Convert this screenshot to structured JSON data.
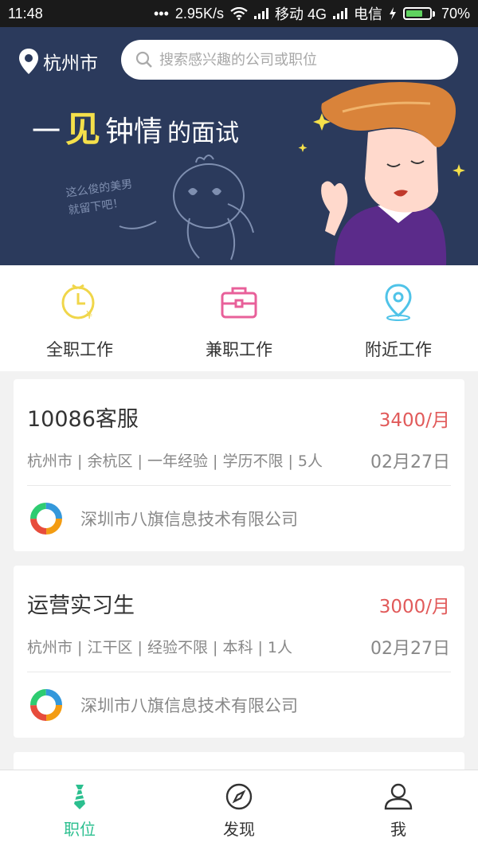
{
  "status_bar": {
    "time": "11:48",
    "dots": "•••",
    "net_speed": "2.95K/s",
    "carrier1": "移动 4G",
    "carrier2": "电信",
    "battery": "70%",
    "battery_level": 0.7
  },
  "banner": {
    "city": "杭州市",
    "search_placeholder": "搜索感兴趣的公司或职位",
    "headline_pre": "一",
    "headline_big": "见",
    "headline_mid": "钟情",
    "headline_post": "的面试",
    "scribble_line1": "这么俊的美男",
    "scribble_line2": "就留下吧！",
    "colors": {
      "background": "#2b3a5c",
      "accent": "#f5e04a"
    }
  },
  "categories": [
    {
      "label": "全职工作",
      "icon": "clock-money-icon",
      "color": "#f0d64a"
    },
    {
      "label": "兼职工作",
      "icon": "briefcase-icon",
      "color": "#e8609a"
    },
    {
      "label": "附近工作",
      "icon": "location-pin-icon",
      "color": "#4fc3e8"
    }
  ],
  "jobs": [
    {
      "title": "10086客服",
      "salary": "3400/月",
      "meta": "杭州市 | 余杭区 | 一年经验 | 学历不限 | 5人",
      "date": "02月27日",
      "company": "深圳市八旗信息技术有限公司"
    },
    {
      "title": "运营实习生",
      "salary": "3000/月",
      "meta": "杭州市 | 江干区 | 经验不限 | 本科 | 1人",
      "date": "02月27日",
      "company": "深圳市八旗信息技术有限公司"
    }
  ],
  "tabbar": {
    "items": [
      {
        "label": "职位",
        "icon": "tie-icon",
        "active": true
      },
      {
        "label": "发现",
        "icon": "compass-icon",
        "active": false
      },
      {
        "label": "我",
        "icon": "person-icon",
        "active": false
      }
    ],
    "active_color": "#2bbf8f"
  }
}
